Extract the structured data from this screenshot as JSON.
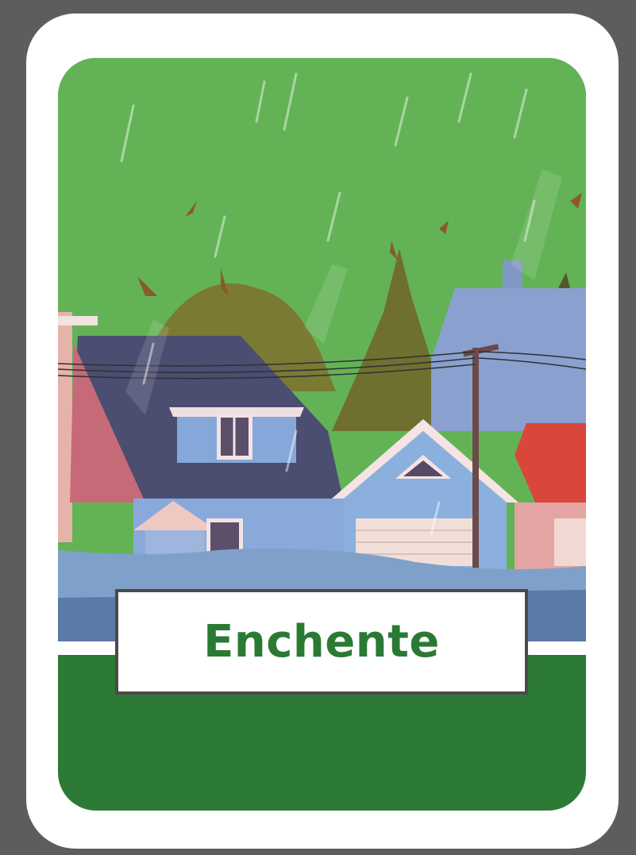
{
  "card": {
    "label": "Enchente",
    "label_color": "#2a7a34",
    "sky_color": "#63b356",
    "bottom_color": "#2c7a35"
  },
  "illustration": {
    "subject": "flooded-neighborhood",
    "elements": [
      "houses",
      "trees",
      "utility-pole",
      "power-lines",
      "rain",
      "flood-water",
      "falling-leaves"
    ]
  }
}
